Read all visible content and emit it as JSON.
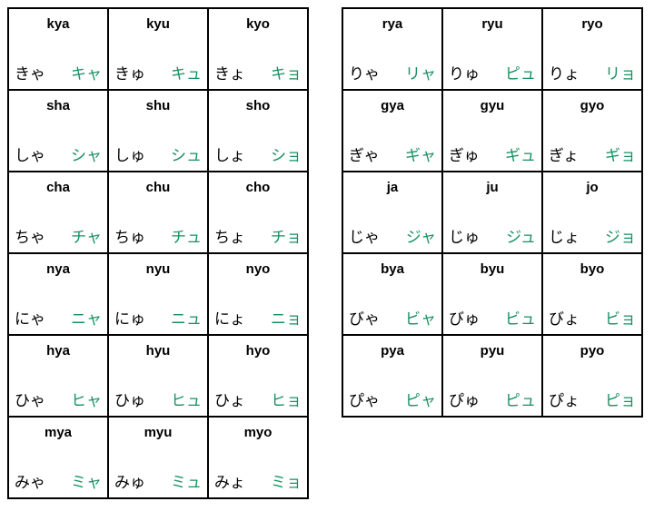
{
  "left": [
    [
      {
        "romaji": "kya",
        "hira": "きゃ",
        "kata": "キャ"
      },
      {
        "romaji": "kyu",
        "hira": "きゅ",
        "kata": "キュ"
      },
      {
        "romaji": "kyo",
        "hira": "きょ",
        "kata": "キョ"
      }
    ],
    [
      {
        "romaji": "sha",
        "hira": "しゃ",
        "kata": "シャ"
      },
      {
        "romaji": "shu",
        "hira": "しゅ",
        "kata": "シュ"
      },
      {
        "romaji": "sho",
        "hira": "しょ",
        "kata": "ショ"
      }
    ],
    [
      {
        "romaji": "cha",
        "hira": "ちゃ",
        "kata": "チャ"
      },
      {
        "romaji": "chu",
        "hira": "ちゅ",
        "kata": "チュ"
      },
      {
        "romaji": "cho",
        "hira": "ちょ",
        "kata": "チョ"
      }
    ],
    [
      {
        "romaji": "nya",
        "hira": "にゃ",
        "kata": "ニャ"
      },
      {
        "romaji": "nyu",
        "hira": "にゅ",
        "kata": "ニュ"
      },
      {
        "romaji": "nyo",
        "hira": "にょ",
        "kata": "ニョ"
      }
    ],
    [
      {
        "romaji": "hya",
        "hira": "ひゃ",
        "kata": "ヒャ"
      },
      {
        "romaji": "hyu",
        "hira": "ひゅ",
        "kata": "ヒュ"
      },
      {
        "romaji": "hyo",
        "hira": "ひょ",
        "kata": "ヒョ"
      }
    ],
    [
      {
        "romaji": "mya",
        "hira": "みゃ",
        "kata": "ミャ"
      },
      {
        "romaji": "myu",
        "hira": "みゅ",
        "kata": "ミュ"
      },
      {
        "romaji": "myo",
        "hira": "みょ",
        "kata": "ミョ"
      }
    ]
  ],
  "right": [
    [
      {
        "romaji": "rya",
        "hira": "りゃ",
        "kata": "リャ"
      },
      {
        "romaji": "ryu",
        "hira": "りゅ",
        "kata": "ピュ"
      },
      {
        "romaji": "ryo",
        "hira": "りょ",
        "kata": "リョ"
      }
    ],
    [
      {
        "romaji": "gya",
        "hira": "ぎゃ",
        "kata": "ギャ"
      },
      {
        "romaji": "gyu",
        "hira": "ぎゅ",
        "kata": "ギュ"
      },
      {
        "romaji": "gyo",
        "hira": "ぎょ",
        "kata": "ギョ"
      }
    ],
    [
      {
        "romaji": "ja",
        "hira": "じゃ",
        "kata": "ジャ"
      },
      {
        "romaji": "ju",
        "hira": "じゅ",
        "kata": "ジュ"
      },
      {
        "romaji": "jo",
        "hira": "じょ",
        "kata": "ジョ"
      }
    ],
    [
      {
        "romaji": "bya",
        "hira": "びゃ",
        "kata": "ビャ"
      },
      {
        "romaji": "byu",
        "hira": "びゅ",
        "kata": "ビュ"
      },
      {
        "romaji": "byo",
        "hira": "びょ",
        "kata": "ビョ"
      }
    ],
    [
      {
        "romaji": "pya",
        "hira": "ぴゃ",
        "kata": "ピャ"
      },
      {
        "romaji": "pyu",
        "hira": "ぴゅ",
        "kata": "ピュ"
      },
      {
        "romaji": "pyo",
        "hira": "ぴょ",
        "kata": "ピョ"
      }
    ]
  ]
}
